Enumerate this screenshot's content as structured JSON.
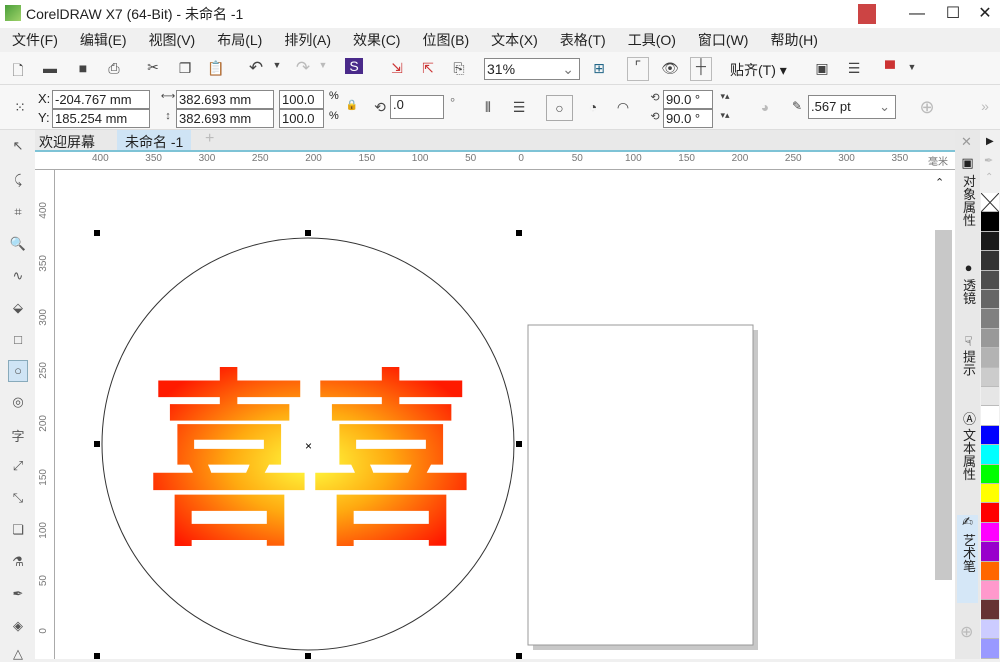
{
  "title": "CorelDRAW X7 (64-Bit) - 未命名 -1",
  "menu": [
    "文件(F)",
    "编辑(E)",
    "视图(V)",
    "布局(L)",
    "排列(A)",
    "效果(C)",
    "位图(B)",
    "文本(X)",
    "表格(T)",
    "工具(O)",
    "窗口(W)",
    "帮助(H)"
  ],
  "toolbar": {
    "zoom": "31%",
    "snap": "贴齐(T)"
  },
  "props": {
    "x_label": "X:",
    "x": "-204.767 mm",
    "y_label": "Y:",
    "y": "185.254 mm",
    "w": "382.693 mm",
    "h": "382.693 mm",
    "sx": "100.0",
    "sy": "100.0",
    "pct": "%",
    "rotation": ".0",
    "deg": "°",
    "start_angle": "90.0 °",
    "end_angle": "90.0 °",
    "outline": ".567 pt"
  },
  "tabs": [
    "欢迎屏幕",
    "未命名 -1"
  ],
  "hruler": {
    "labels": [
      "400",
      "350",
      "300",
      "250",
      "200",
      "150",
      "100",
      "50",
      "0",
      "50",
      "100",
      "150",
      "200",
      "250",
      "300",
      "350"
    ],
    "unit": "毫米"
  },
  "vruler": {
    "labels": [
      "400",
      "350",
      "300",
      "250",
      "200",
      "150",
      "100",
      "50",
      "0"
    ]
  },
  "canvas_text": "喜喜",
  "docker_tabs": [
    "对象属性",
    "透镜",
    "提示",
    "文本属性",
    "艺术笔"
  ],
  "palette": [
    "none",
    "#000000",
    "#1a1a1a",
    "#333333",
    "#4d4d4d",
    "#666666",
    "#808080",
    "#999999",
    "#b3b3b3",
    "#cccccc",
    "#e6e6e6",
    "#ffffff",
    "#0000ff",
    "#00ffff",
    "#00ff00",
    "#ffff00",
    "#ff0000",
    "#ff00ff",
    "#9900cc",
    "#ff6600",
    "#ff99cc",
    "#663333",
    "#ccccff",
    "#9999ff"
  ]
}
